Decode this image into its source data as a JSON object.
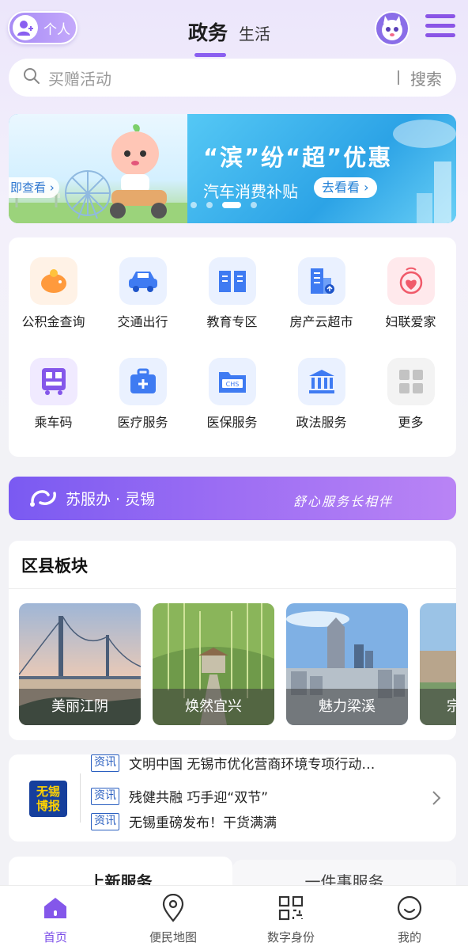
{
  "header": {
    "personal_label": "个人",
    "tabs": [
      {
        "label": "政务",
        "active": true
      },
      {
        "label": "生活",
        "active": false
      }
    ]
  },
  "search": {
    "placeholder": "买赠活动",
    "button_label": "搜索"
  },
  "banner": {
    "title": "“滨”纷“超”优惠",
    "subtitle": "汽车消费补贴",
    "cta_label": "去看看",
    "left_link_label": "即查看",
    "dots_total": 4,
    "dots_active_index": 2
  },
  "services": [
    {
      "label": "公积金查询",
      "icon": "piggy-bank-icon",
      "color": "#ff9a3c",
      "bg": "#fff2e6"
    },
    {
      "label": "交通出行",
      "icon": "car-icon",
      "color": "#3f7bf2",
      "bg": "#eaf1ff"
    },
    {
      "label": "教育专区",
      "icon": "book-icon",
      "color": "#3f7bf2",
      "bg": "#eaf1ff"
    },
    {
      "label": "房产云超市",
      "icon": "building-icon",
      "color": "#3f7bf2",
      "bg": "#eaf1ff"
    },
    {
      "label": "妇联爱家",
      "icon": "women-federation-icon",
      "color": "#f05a6a",
      "bg": "#ffe9ec"
    },
    {
      "label": "乘车码",
      "icon": "qr-bus-icon",
      "color": "#8457ea",
      "bg": "#f0eaff"
    },
    {
      "label": "医疗服务",
      "icon": "medical-kit-icon",
      "color": "#3f7bf2",
      "bg": "#eaf1ff"
    },
    {
      "label": "医保服务",
      "icon": "chs-folder-icon",
      "color": "#3f7bf2",
      "bg": "#eaf1ff"
    },
    {
      "label": "政法服务",
      "icon": "court-building-icon",
      "color": "#3f7bf2",
      "bg": "#eaf1ff"
    },
    {
      "label": "更多",
      "icon": "grid-more-icon",
      "color": "#b8b8b8",
      "bg": "#f3f3f3"
    }
  ],
  "sufuban": {
    "label": "苏服办 · 灵锡",
    "slogan": "舒心服务长相伴"
  },
  "district": {
    "title": "区县板块",
    "cards": [
      {
        "label": "美丽江阴"
      },
      {
        "label": "焕然宜兴"
      },
      {
        "label": "魅力梁溪"
      },
      {
        "label": "宗"
      }
    ]
  },
  "news": {
    "logo_text": "无锡博报",
    "items": [
      {
        "tag": "资讯",
        "text": "文明中国 无锡市优化营商环境专项行动…"
      },
      {
        "tag": "资讯",
        "text": "残健共融  巧手迎“双节”"
      },
      {
        "tag": "资讯",
        "text": "无锡重磅发布！干货满满"
      }
    ]
  },
  "service_tabs": [
    {
      "label": "上新服务",
      "active": true
    },
    {
      "label": "一件事服务",
      "active": false
    }
  ],
  "bottom_nav": [
    {
      "label": "首页",
      "icon": "home-icon",
      "active": true
    },
    {
      "label": "便民地图",
      "icon": "map-pin-icon",
      "active": false
    },
    {
      "label": "数字身份",
      "icon": "qr-scan-icon",
      "active": false
    },
    {
      "label": "我的",
      "icon": "smiley-icon",
      "active": false
    }
  ],
  "colors": {
    "accent": "#8457ea",
    "banner_blue": "#36aee8"
  }
}
